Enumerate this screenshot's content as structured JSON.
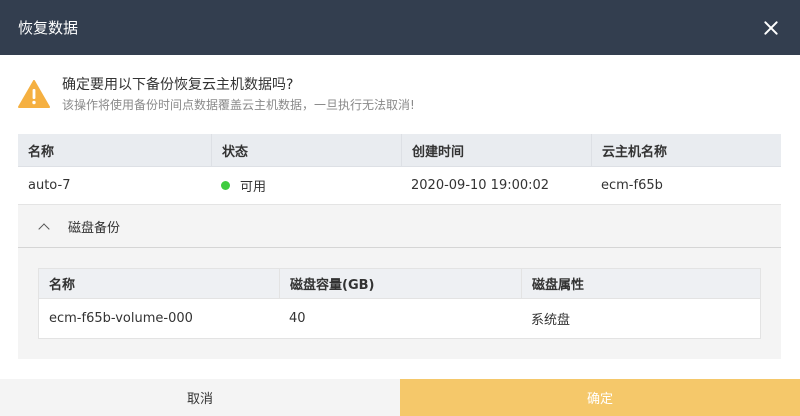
{
  "dialog": {
    "title": "恢复数据",
    "close_icon": "close-icon"
  },
  "warning": {
    "icon": "warning-icon",
    "icon_color": "#f5b041",
    "title": "确定要用以下备份恢复云主机数据吗?",
    "description": "该操作将使用备份时间点数据覆盖云主机数据，一旦执行无法取消!"
  },
  "backup_table": {
    "columns": [
      "名称",
      "状态",
      "创建时间",
      "云主机名称"
    ],
    "rows": [
      {
        "name": "auto-7",
        "status": "可用",
        "status_color": "#3fcc3f",
        "created": "2020-09-10 19:00:02",
        "host": "ecm-f65b"
      }
    ]
  },
  "disk_section": {
    "label": "磁盘备份",
    "expanded": true,
    "columns": [
      "名称",
      "磁盘容量(GB)",
      "磁盘属性"
    ],
    "rows": [
      {
        "name": "ecm-f65b-volume-000",
        "capacity": "40",
        "type": "系统盘"
      }
    ]
  },
  "footer": {
    "cancel_label": "取消",
    "confirm_label": "确定",
    "confirm_color": "#f5c86a"
  }
}
